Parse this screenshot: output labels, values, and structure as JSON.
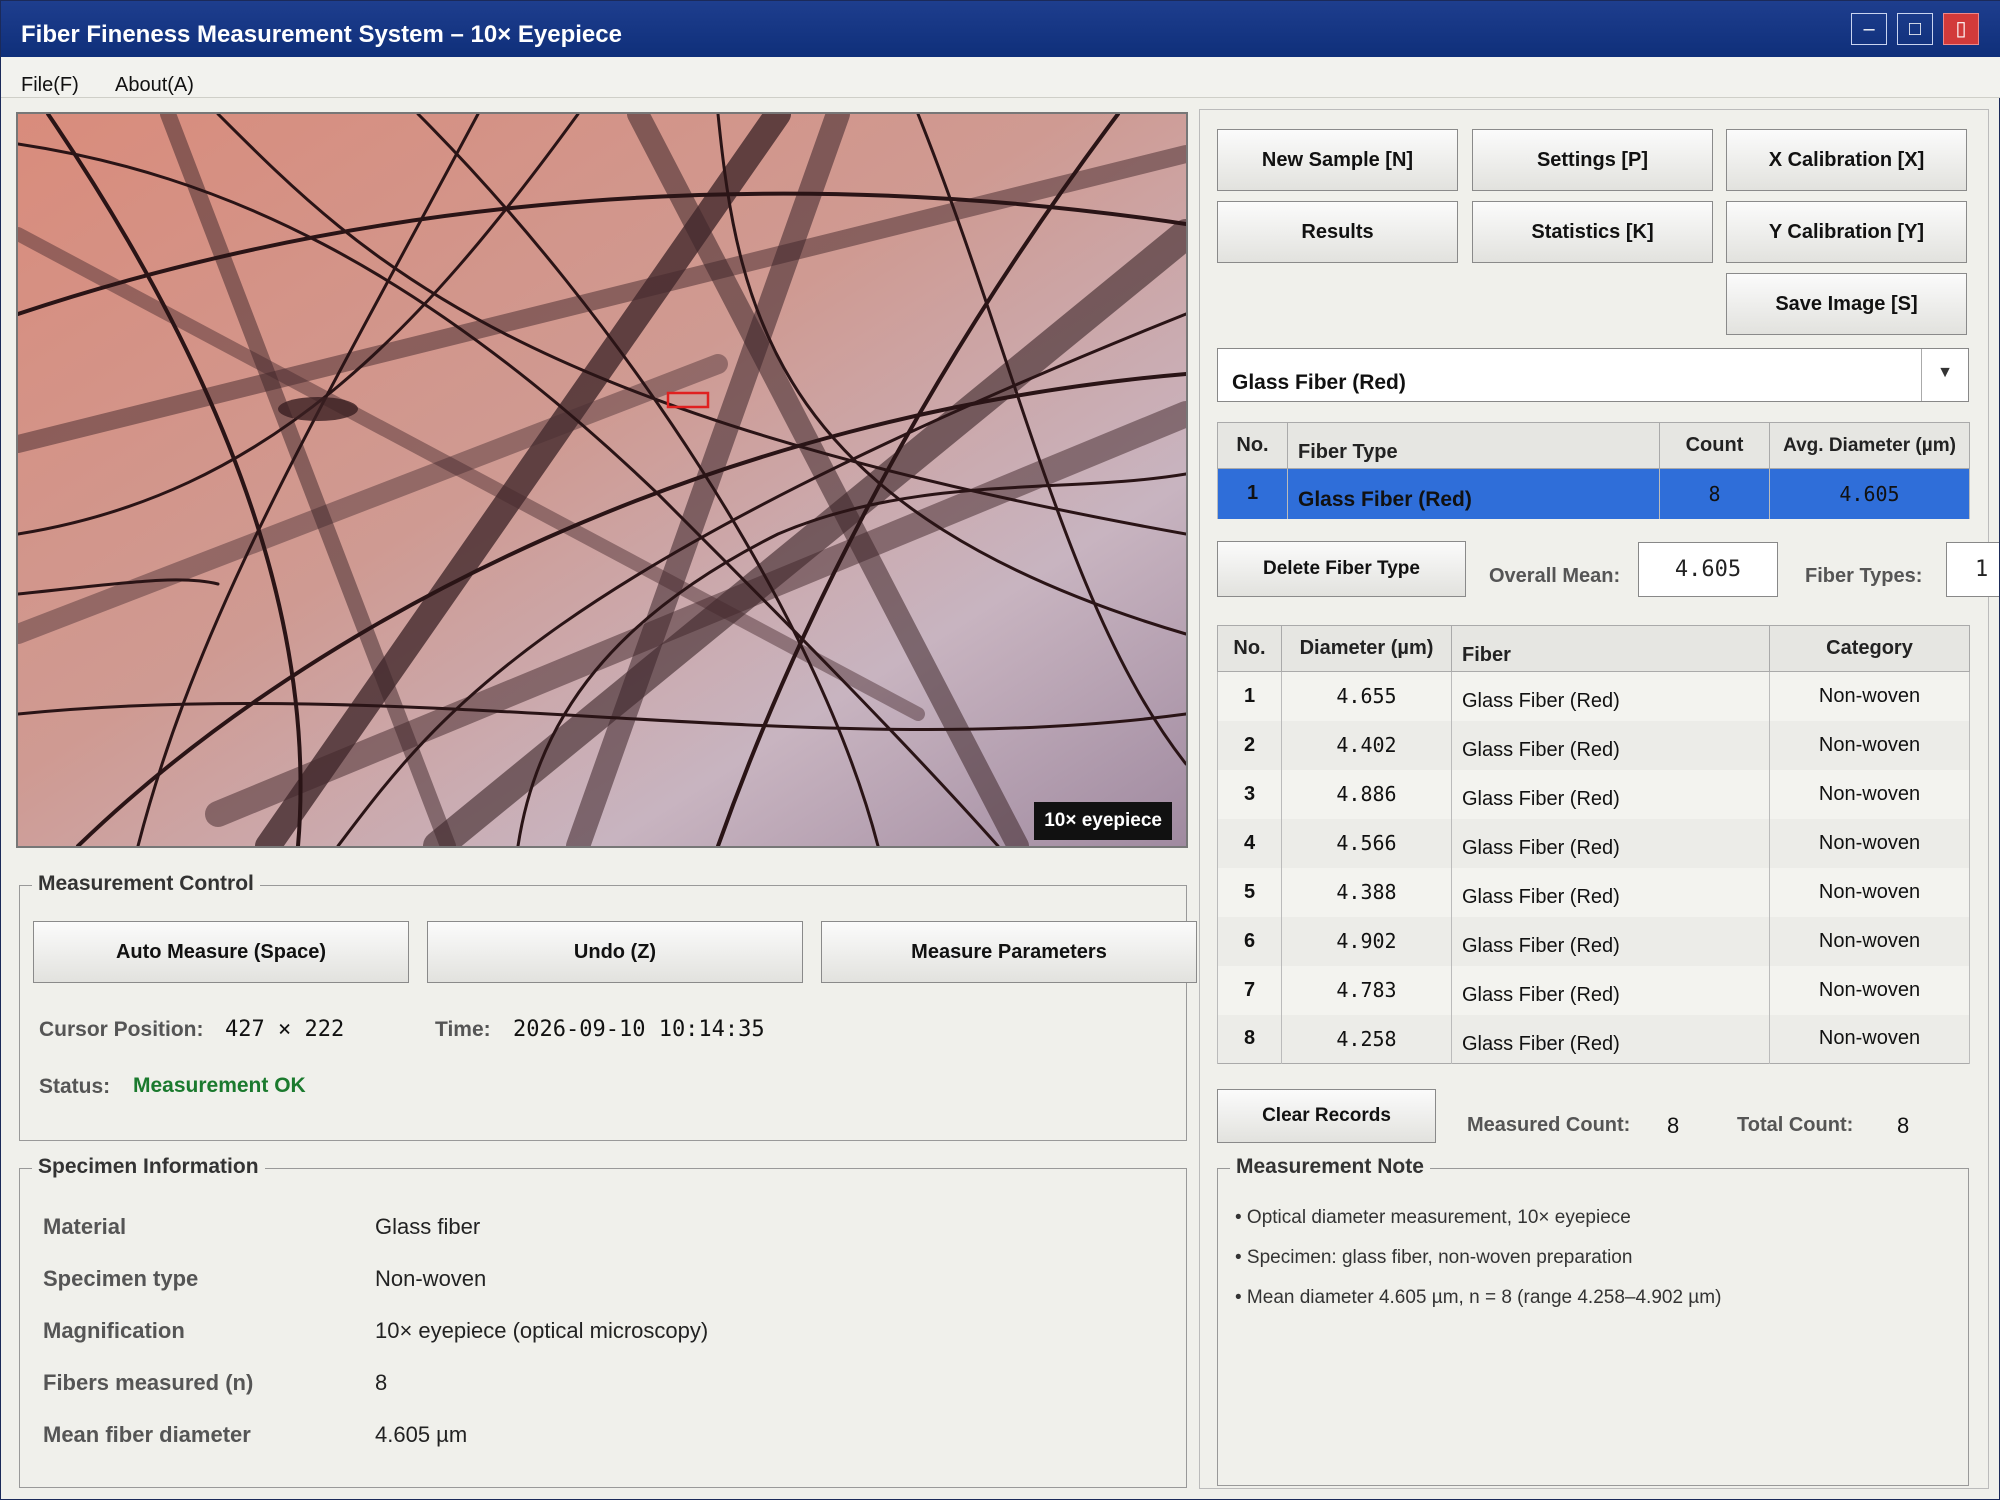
{
  "window": {
    "title": "Fiber Fineness Measurement System  –  10× Eyepiece",
    "minimize": "–",
    "maximize": "□",
    "close": "▯"
  },
  "menu": [
    "File(F)",
    "About(A)"
  ],
  "image": {
    "eyepiece_label": "10× eyepiece"
  },
  "measurement_control": {
    "title": "Measurement Control",
    "buttons": [
      "Auto Measure (Space)",
      "Undo (Z)",
      "Measure Parameters"
    ],
    "cursor_label": "Cursor Position:",
    "cursor_value": "427 × 222",
    "time_label": "Time:",
    "time_value": "2026-09-10 10:14:35",
    "status_label": "Status:",
    "status_value": "Measurement OK",
    "status_color": "#1b7a2e"
  },
  "specimen": {
    "title": "Specimen Information",
    "rows": [
      {
        "label": "Material",
        "value": "Glass fiber"
      },
      {
        "label": "Specimen type",
        "value": "Non-woven"
      },
      {
        "label": "Magnification",
        "value": "10× eyepiece (optical microscopy)"
      },
      {
        "label": "Fibers measured (n)",
        "value": "8"
      },
      {
        "label": "Mean fiber diameter",
        "value": "4.605 µm"
      }
    ]
  },
  "toolbar": {
    "new_sample": "New Sample [N]",
    "settings": "Settings [P]",
    "x_calibration": "X Calibration [X]",
    "results": "Results",
    "statistics": "Statistics [K]",
    "y_calibration": "Y Calibration [Y]",
    "save_image": "Save Image [S]"
  },
  "fiber_select": {
    "value": "Glass Fiber (Red)",
    "arrow": "▼"
  },
  "type_table": {
    "headers": [
      "No.",
      "Fiber Type",
      "Count",
      "Avg. Diameter (µm)"
    ],
    "rows": [
      {
        "no": "1",
        "type": "Glass Fiber (Red)",
        "count": "8",
        "avg": "4.605"
      }
    ],
    "selected_color": "#2f6ed9"
  },
  "type_controls": {
    "delete_button": "Delete Fiber Type",
    "overall_mean_label": "Overall Mean:",
    "overall_mean_value": "4.605",
    "fiber_types_label": "Fiber Types:",
    "fiber_types_value": "1"
  },
  "records_table": {
    "headers": [
      "No.",
      "Diameter (µm)",
      "Fiber",
      "Category"
    ],
    "rows": [
      {
        "no": "1",
        "diameter": "4.655",
        "fiber": "Glass Fiber (Red)",
        "category": "Non-woven"
      },
      {
        "no": "2",
        "diameter": "4.402",
        "fiber": "Glass Fiber (Red)",
        "category": "Non-woven"
      },
      {
        "no": "3",
        "diameter": "4.886",
        "fiber": "Glass Fiber (Red)",
        "category": "Non-woven"
      },
      {
        "no": "4",
        "diameter": "4.566",
        "fiber": "Glass Fiber (Red)",
        "category": "Non-woven"
      },
      {
        "no": "5",
        "diameter": "4.388",
        "fiber": "Glass Fiber (Red)",
        "category": "Non-woven"
      },
      {
        "no": "6",
        "diameter": "4.902",
        "fiber": "Glass Fiber (Red)",
        "category": "Non-woven"
      },
      {
        "no": "7",
        "diameter": "4.783",
        "fiber": "Glass Fiber (Red)",
        "category": "Non-woven"
      },
      {
        "no": "8",
        "diameter": "4.258",
        "fiber": "Glass Fiber (Red)",
        "category": "Non-woven"
      }
    ]
  },
  "records_controls": {
    "clear_button": "Clear Records",
    "measured_label": "Measured Count:",
    "measured_value": "8",
    "total_label": "Total Count:",
    "total_value": "8"
  },
  "note": {
    "title": "Measurement Note",
    "lines": [
      "• Optical diameter measurement, 10× eyepiece",
      "• Specimen: glass fiber, non-woven preparation",
      "• Mean diameter 4.605 µm, n = 8 (range 4.258–4.902 µm)"
    ]
  }
}
